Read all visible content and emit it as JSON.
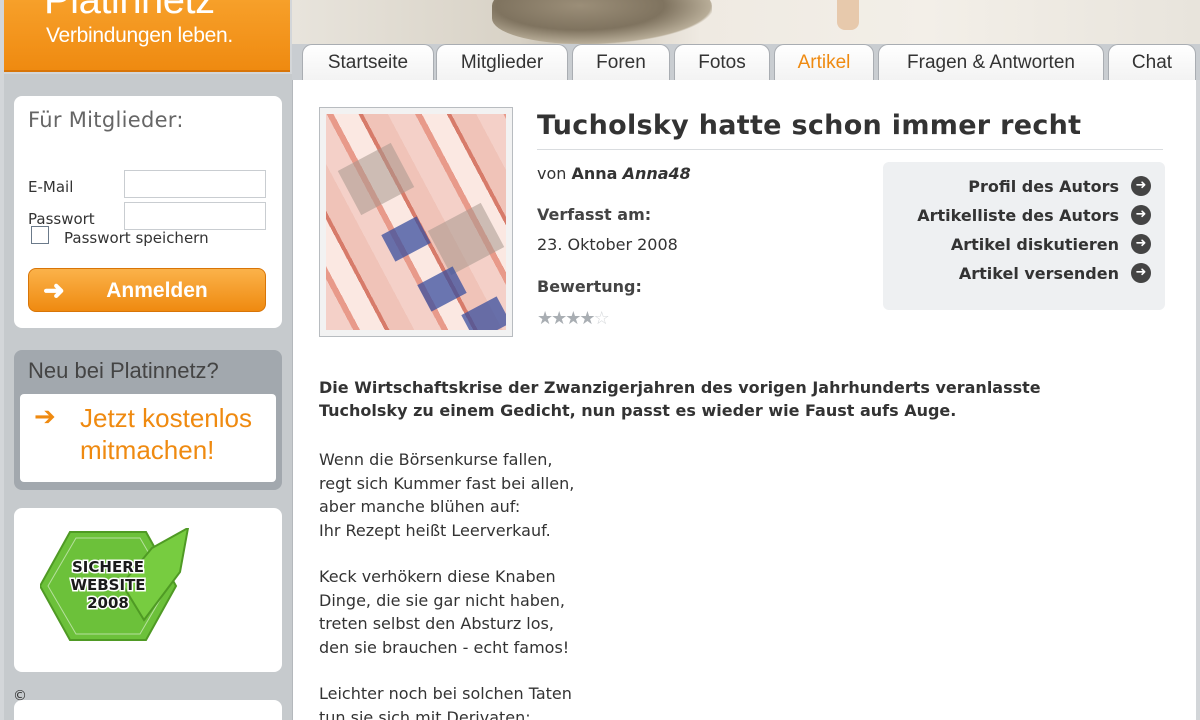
{
  "header": {
    "brand": "Platinnetz",
    "tagline": "Verbindungen leben."
  },
  "tabs": [
    {
      "label": "Startseite",
      "active": false
    },
    {
      "label": "Mitglieder",
      "active": false
    },
    {
      "label": "Foren",
      "active": false
    },
    {
      "label": "Fotos",
      "active": false
    },
    {
      "label": "Artikel",
      "active": true
    },
    {
      "label": "Fragen & Antworten",
      "active": false
    },
    {
      "label": "Chat",
      "active": false
    }
  ],
  "login": {
    "title": "Für Mitglieder:",
    "email_label": "E-Mail",
    "email_value": "",
    "password_label": "Passwort",
    "password_value": "",
    "remember_label": "Passwort speichern",
    "remember_checked": false,
    "submit_label": "Anmelden"
  },
  "signup": {
    "title": "Neu bei Platinnetz?",
    "cta": "Jetzt kostenlos mitmachen!"
  },
  "seal": {
    "line1": "SICHERE",
    "line2": "WEBSITE",
    "line3": "2008"
  },
  "copyright": "©",
  "article": {
    "title": "Tucholsky hatte schon immer recht",
    "by": "von",
    "author_name": "Anna",
    "author_nick": "Anna48",
    "written_label": "Verfasst am:",
    "written_date": "23. Oktober 2008",
    "rating_label": "Bewertung:",
    "rating_value": 4,
    "rating_max": 5,
    "lead": "Die Wirtschaftskrise der Zwanzigerjahren des vorigen Jahrhunderts veranlasste Tucholsky zu einem Gedicht, nun passt es wieder wie Faust aufs Auge.",
    "stanzas": [
      [
        "Wenn die Börsenkurse fallen,",
        "regt sich Kummer fast bei allen,",
        "aber manche blühen auf:",
        "Ihr Rezept heißt Leerverkauf."
      ],
      [
        "Keck verhökern diese Knaben",
        "Dinge, die sie gar nicht haben,",
        "treten selbst den Absturz los,",
        "den sie brauchen - echt famos!"
      ],
      [
        "Leichter noch bei solchen Taten",
        "tun sie sich mit Derivaten:"
      ]
    ]
  },
  "actions": [
    {
      "label": "Profil des Autors"
    },
    {
      "label": "Artikelliste des Autors"
    },
    {
      "label": "Artikel diskutieren"
    },
    {
      "label": "Artikel versenden"
    }
  ],
  "colors": {
    "accent": "#ef8a10",
    "sidebar": "#c6cacd"
  }
}
